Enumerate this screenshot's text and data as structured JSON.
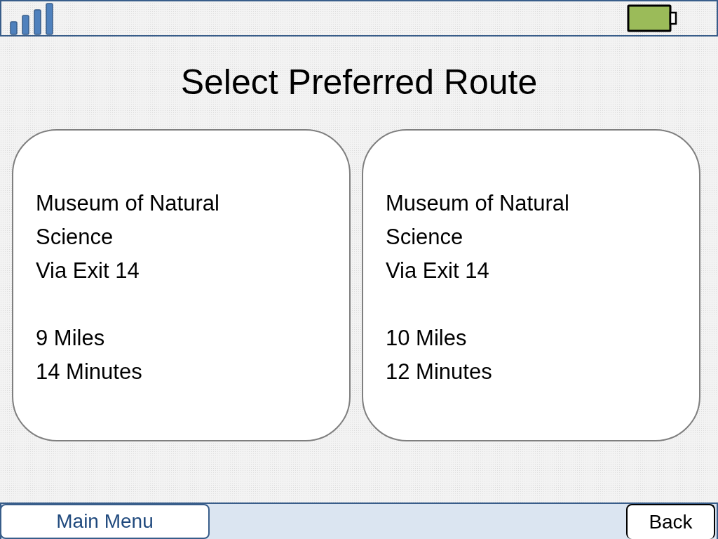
{
  "title": "Select Preferred Route",
  "routes": [
    {
      "destination": "Museum of Natural Science",
      "via": "Via Exit 14",
      "distance": "9 Miles",
      "duration": "14 Minutes"
    },
    {
      "destination": "Museum of Natural Science",
      "via": "Via Exit 14",
      "distance": "10 Miles",
      "duration": "12 Minutes"
    }
  ],
  "buttons": [
    {
      "label": "Main Menu",
      "kind": "primary"
    },
    {
      "label": "Back",
      "kind": "secondary"
    }
  ]
}
